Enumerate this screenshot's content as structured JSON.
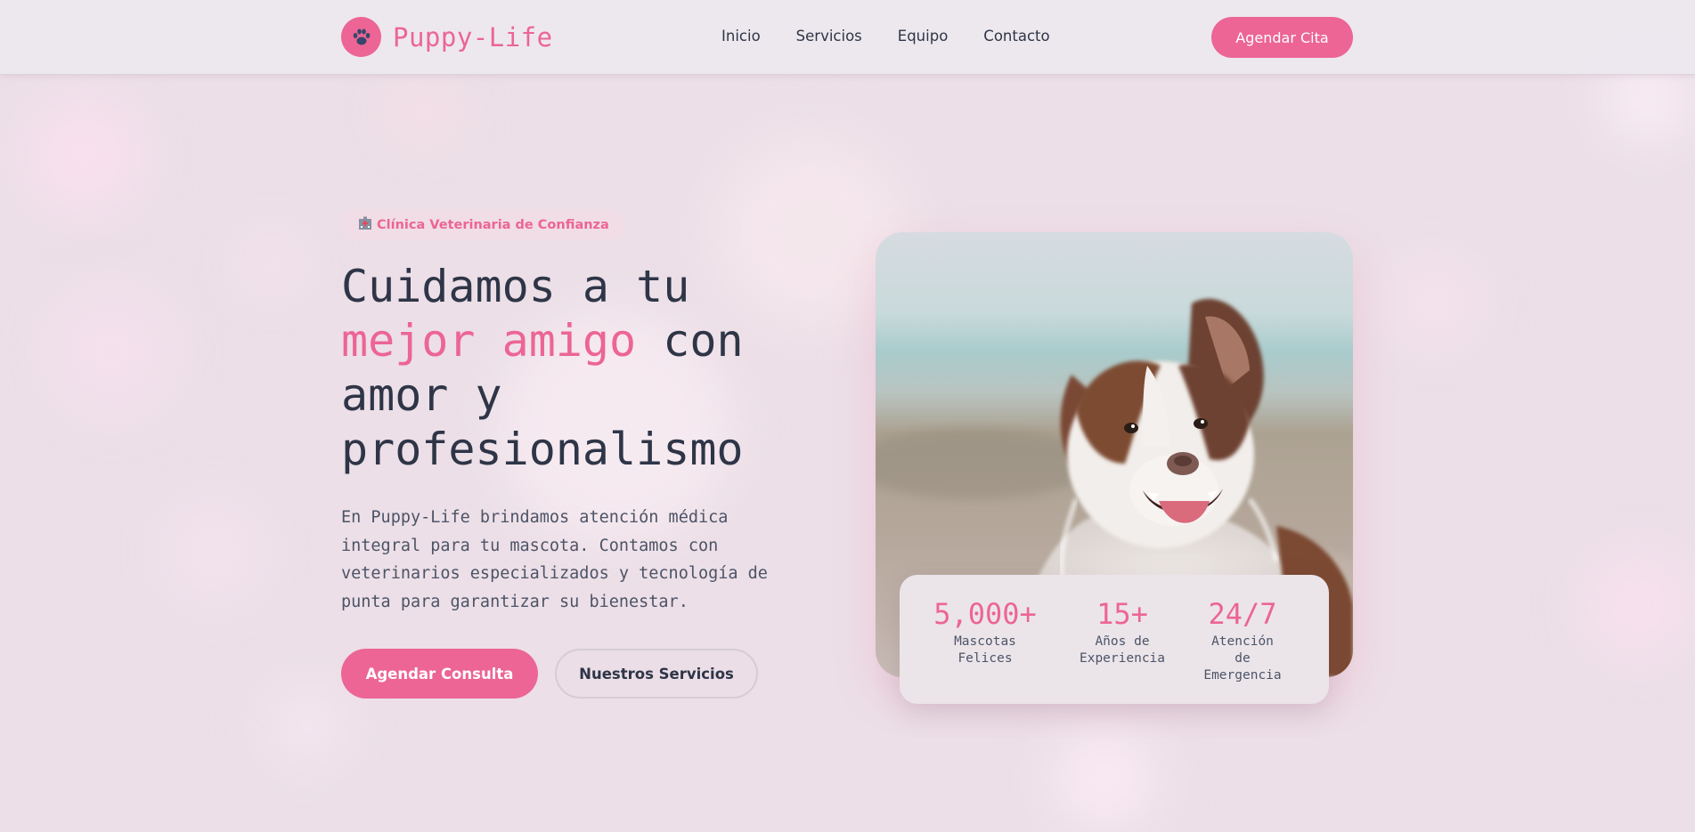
{
  "brand": {
    "name": "Puppy-Life",
    "logo_icon": "paw-icon",
    "accent_color": "#ec6594",
    "text_color": "#2e3547"
  },
  "nav": {
    "items": [
      {
        "label": "Inicio"
      },
      {
        "label": "Servicios"
      },
      {
        "label": "Equipo"
      },
      {
        "label": "Contacto"
      }
    ],
    "cta_label": "Agendar Cita"
  },
  "hero": {
    "badge_icon": "clinic-icon",
    "badge_text": "Clínica Veterinaria de Confianza",
    "headline_part1": "Cuidamos a tu",
    "headline_accent": "mejor amigo",
    "headline_part2": "con amor y profesionalismo",
    "description": "En Puppy-Life brindamos atención médica integral para tu mascota. Contamos con veterinarios especializados y tecnología de punta para garantizar su bienestar.",
    "primary_button": "Agendar Consulta",
    "secondary_button": "Nuestros Servicios"
  },
  "stats": [
    {
      "value": "5,000+",
      "label": "Mascotas Felices"
    },
    {
      "value": "15+",
      "label": "Años de Experiencia"
    },
    {
      "value": "24/7",
      "label": "Atención de Emergencia"
    }
  ]
}
